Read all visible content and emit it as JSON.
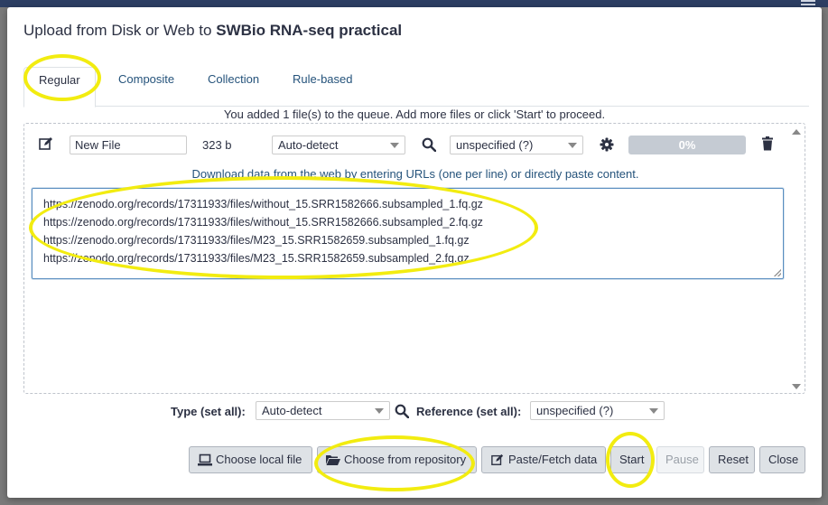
{
  "window": {
    "title_prefix": "Upload from Disk or Web to ",
    "title_history": "SWBio RNA-seq practical"
  },
  "tabs": [
    {
      "label": "Regular",
      "active": true
    },
    {
      "label": "Composite",
      "active": false
    },
    {
      "label": "Collection",
      "active": false
    },
    {
      "label": "Rule-based",
      "active": false
    }
  ],
  "queue_message": "You added 1 file(s) to the queue. Add more files or click 'Start' to proceed.",
  "file_row": {
    "name": "New File",
    "size": "323 b",
    "type": "Auto-detect",
    "reference": "unspecified (?)",
    "progress_label": "0%",
    "progress_value": 0
  },
  "paste_hint": "Download data from the web by entering URLs (one per line) or directly paste content.",
  "urls": [
    "https://zenodo.org/records/17311933/files/without_15.SRR1582666.subsampled_1.fq.gz",
    "https://zenodo.org/records/17311933/files/without_15.SRR1582666.subsampled_2.fq.gz",
    "https://zenodo.org/records/17311933/files/M23_15.SRR1582659.subsampled_1.fq.gz",
    "https://zenodo.org/records/17311933/files/M23_15.SRR1582659.subsampled_2.fq.gz"
  ],
  "set_all": {
    "type_label": "Type (set all):",
    "type_value": "Auto-detect",
    "reference_label": "Reference (set all):",
    "reference_value": "unspecified (?)"
  },
  "buttons": {
    "choose_local": "Choose local file",
    "choose_repository": "Choose from repository",
    "paste_fetch": "Paste/Fetch data",
    "start": "Start",
    "pause": "Pause",
    "reset": "Reset",
    "close": "Close"
  },
  "colors": {
    "header_bar": "#2c3e63",
    "link": "#25537b",
    "highlight": "#f2ec10",
    "button_bg": "#dee2e6"
  }
}
